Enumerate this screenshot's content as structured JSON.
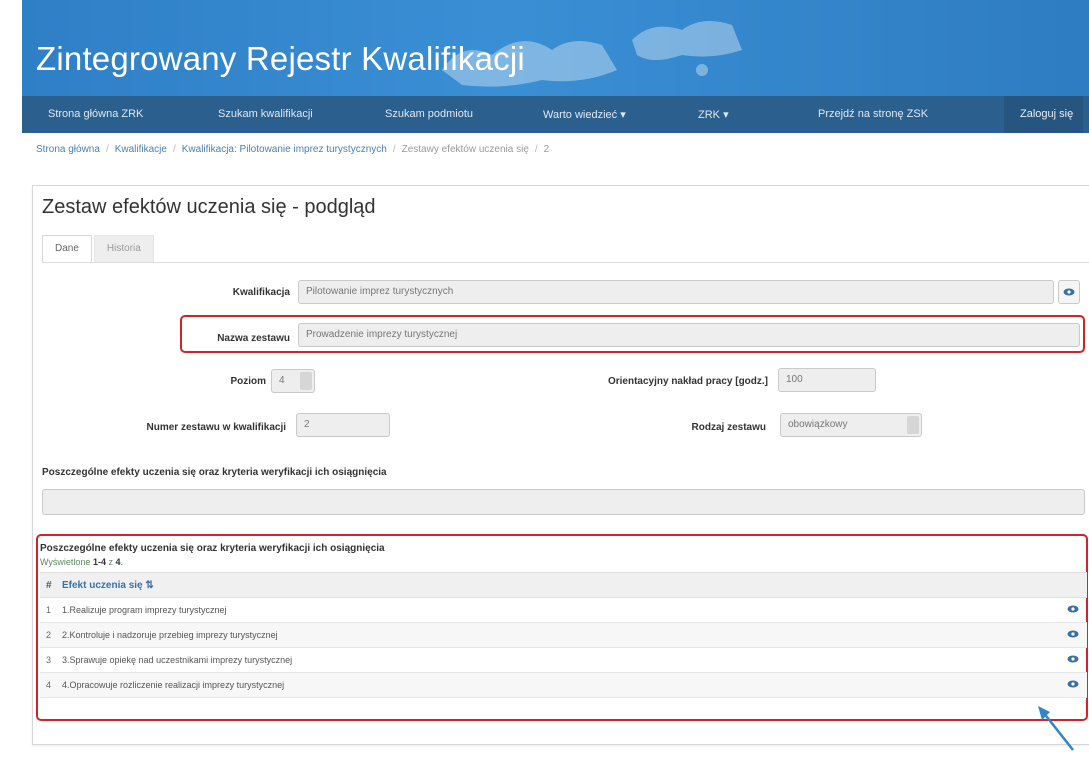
{
  "header": {
    "title": "Zintegrowany Rejestr Kwalifikacji",
    "brand_color": "#2f7fc6"
  },
  "nav": {
    "items": [
      {
        "label": "Strona główna ZRK"
      },
      {
        "label": "Szukam kwalifikacji"
      },
      {
        "label": "Szukam podmiotu"
      },
      {
        "label": "Warto wiedzieć"
      },
      {
        "label": "ZRK"
      },
      {
        "label": "Przejdź na stronę ZSK"
      }
    ],
    "login_label": "Zaloguj się"
  },
  "breadcrumb": {
    "items": [
      "Strona główna",
      "Kwalifikacje",
      "Kwalifikacja: Pilotowanie imprez turystycznych",
      "Zestawy efektów uczenia się",
      "2"
    ]
  },
  "page": {
    "title": "Zestaw efektów uczenia się - podgląd"
  },
  "tabs": [
    {
      "label": "Dane"
    },
    {
      "label": "Historia"
    }
  ],
  "form": {
    "kwalifikacja": {
      "label": "Kwalifikacja",
      "value": "Pilotowanie imprez turystycznych"
    },
    "nazwa": {
      "label": "Nazwa zestawu",
      "value": "Prowadzenie imprezy turystycznej"
    },
    "poziom": {
      "label": "Poziom",
      "value": "4"
    },
    "naklad": {
      "label": "Orientacyjny nakład pracy [godz.]",
      "value": "100"
    },
    "numer": {
      "label": "Numer zestawu w kwalifikacji",
      "value": "2"
    },
    "rodzaj": {
      "label": "Rodzaj zestawu",
      "value": "obowiązkowy"
    },
    "efekty_label": "Poszczególne efekty uczenia się oraz kryteria weryfikacji ich osiągnięcia"
  },
  "table": {
    "title": "Poszczególne efekty uczenia się oraz kryteria weryfikacji ich osiągnięcia",
    "shown_prefix": "Wyświetlone ",
    "shown_range": "1-4",
    "shown_mid": " z ",
    "shown_total": "4",
    "col_num": "#",
    "col_label": "Efekt uczenia się",
    "rows": [
      {
        "num": "1",
        "text": "1.Realizuje program imprezy turystycznej"
      },
      {
        "num": "2",
        "text": "2.Kontroluje i nadzoruje przebieg imprezy turystycznej"
      },
      {
        "num": "3",
        "text": "3.Sprawuje opiekę nad uczestnikami imprezy turystycznej"
      },
      {
        "num": "4",
        "text": "4.Opracowuje rozliczenie realizacji imprezy turystycznej"
      }
    ]
  },
  "colors": {
    "highlight": "#d2232a",
    "link": "#4a7fb5",
    "nav_bg": "#2a5f8e"
  }
}
